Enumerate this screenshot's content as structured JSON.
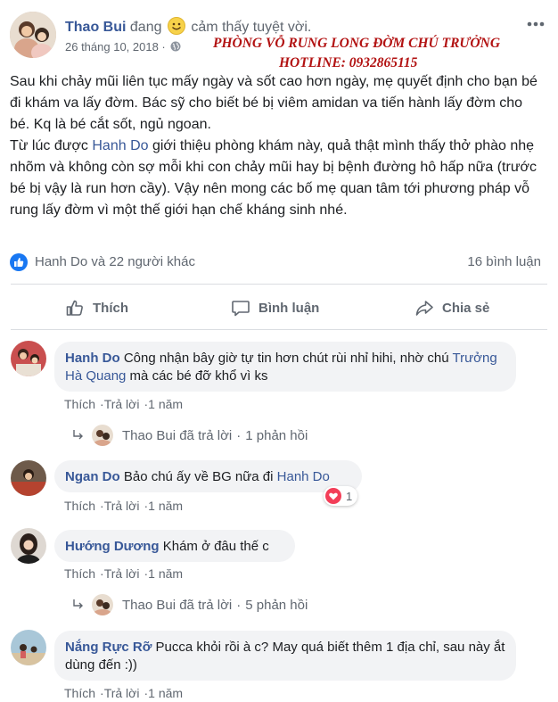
{
  "post": {
    "author": "Thao Bui",
    "feeling_prefix": "đang",
    "feeling_text": "cảm thấy tuyệt vời.",
    "date": "26 tháng 10, 2018 ·",
    "watermark_line1": "PHÒNG VỖ RUNG LONG ĐỜM CHÚ TRƯỞNG",
    "watermark_line2": "HOTLINE: 0932865115",
    "body_p1": "Sau khi chảy mũi liên tục mấy ngày và sốt cao hơn ngày, mẹ quyết định cho bạn bé đi khám va lấy đờm. Bác sỹ cho biết bé bị viêm amidan va tiến hành lấy đờm cho bé. Kq là bé cắt sốt, ngủ ngoan.",
    "body_p2_start": "Từ lúc được ",
    "body_p2_link": "Hanh Do",
    "body_p2_end": " giới thiệu phòng khám này, quả thật mình thấy thở phào nhẹ nhõm và không còn sợ mỗi khi con chảy mũi hay bị bệnh đường hô hấp nữa (trước bé bị vậy là run hơn cầy). Vậy nên mong các bố mẹ quan tâm tới phương pháp vỗ rung lấy đờm vì một thế giới hạn chế kháng sinh nhé.",
    "reactors": "Hanh Do và 22 người khác",
    "comment_count": "16 bình luận"
  },
  "actions": {
    "like": "Thích",
    "comment": "Bình luận",
    "share": "Chia sẻ"
  },
  "comments": [
    {
      "name": "Hanh Do",
      "text_start": "Công nhận bây giờ tự tin hơn chút rùi nhỉ hihi, nhờ chú ",
      "text_link": "Trưởng Hà Quang",
      "text_end": " mà các bé đỡ khổ vì ks",
      "like": "Thích",
      "reply": "Trả lời",
      "time": "1 năm",
      "replies_author": "Thao Bui",
      "replies_label": "đã trả lời",
      "replies_count": "1 phản hồi"
    },
    {
      "name": "Ngan Do",
      "text_start": "Bảo chú ấy về BG nữa đi ",
      "text_link": "Hanh Do",
      "like": "Thích",
      "reply": "Trả lời",
      "time": "1 năm",
      "reaction_count": "1"
    },
    {
      "name": "Hướng Dương",
      "text_start": "Khám ở đâu thế c",
      "like": "Thích",
      "reply": "Trả lời",
      "time": "1 năm",
      "replies_author": "Thao Bui",
      "replies_label": "đã trả lời",
      "replies_count": "5 phản hồi"
    },
    {
      "name": "Nắng Rực Rỡ",
      "text_start": "Pucca khỏi rồi à c? May quá biết thêm 1 địa chỉ, sau này ắt dùng đến :))",
      "like": "Thích",
      "reply": "Trả lời",
      "time": "1 năm"
    }
  ],
  "colors": {
    "link": "#385898",
    "meta": "#606770",
    "bubble": "#f2f3f5",
    "watermark": "#b21212",
    "like_blue": "#1877f2",
    "heart_red": "#f33e58"
  },
  "icons": [
    "smiley-icon",
    "globe-icon",
    "more-icon",
    "like-badge-icon",
    "thumbs-up-icon",
    "comment-icon",
    "share-icon",
    "reply-arrow-icon",
    "heart-icon"
  ]
}
